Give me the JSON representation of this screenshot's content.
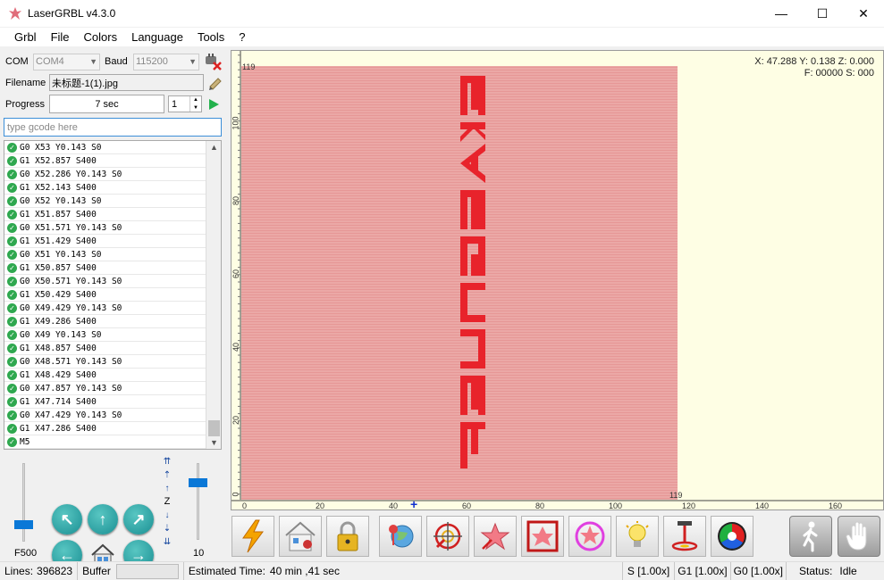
{
  "window": {
    "title": "LaserGRBL v4.3.0",
    "controls": {
      "minimize": "—",
      "maximize": "☐",
      "close": "✕"
    }
  },
  "menu": [
    "Grbl",
    "File",
    "Colors",
    "Language",
    "Tools",
    "?"
  ],
  "connection": {
    "com_label": "COM",
    "com_value": "COM4",
    "baud_label": "Baud",
    "baud_value": "115200"
  },
  "file": {
    "filename_label": "Filename",
    "filename_value": "未标题-1(1).jpg"
  },
  "progress": {
    "label": "Progress",
    "time": "7 sec",
    "passes": "1"
  },
  "gcode_input": {
    "placeholder": "type gcode here"
  },
  "gcode_lines": [
    "G0 X53 Y0.143 S0",
    "G1 X52.857 S400",
    "G0 X52.286 Y0.143 S0",
    "G1 X52.143 S400",
    "G0 X52 Y0.143 S0",
    "G1 X51.857 S400",
    "G0 X51.571 Y0.143 S0",
    "G1 X51.429 S400",
    "G0 X51 Y0.143 S0",
    "G1 X50.857 S400",
    "G0 X50.571 Y0.143 S0",
    "G1 X50.429 S400",
    "G0 X49.429 Y0.143 S0",
    "G1 X49.286 S400",
    "G0 X49 Y0.143 S0",
    "G1 X48.857 S400",
    "G0 X48.571 Y0.143 S0",
    "G1 X48.429 S400",
    "G0 X47.857 Y0.143 S0",
    "G1 X47.714 S400",
    "G0 X47.429 Y0.143 S0",
    "G1 X47.286 S400",
    "M5"
  ],
  "jog": {
    "feed_label": "F500",
    "step_label": "10",
    "z_label": "Z",
    "feed_level": 0.2,
    "step_level": 0.78
  },
  "canvas": {
    "coords_line1": "X: 47.288 Y: 0.138 Z: 0.000",
    "coords_line2": "F: 00000 S: 000",
    "corner_top": "119",
    "corner_right": "119",
    "engraved_text": "FEUNGSAKE",
    "y_ticks": [
      "100",
      "80",
      "60",
      "40",
      "20",
      "0"
    ],
    "x_ticks": [
      "0",
      "20",
      "40",
      "60",
      "80",
      "100",
      "120",
      "140",
      "160"
    ],
    "bg_color": "#fefee4",
    "engrave_color": "#eba8a6",
    "text_color": "#e8232b"
  },
  "toolbar": [
    "flash-icon",
    "home-lock-icon",
    "lock-icon",
    "globe-icon",
    "crosshair-icon",
    "star-icon",
    "frame-icon",
    "ring-icon",
    "bulb-icon",
    "focus-icon",
    "tricolor-icon",
    "walk-icon",
    "hand-icon"
  ],
  "status": {
    "lines_label": "Lines:",
    "lines_value": "396823",
    "buffer_label": "Buffer",
    "estimated_label": "Estimated Time:",
    "estimated_value": "40 min ,41 sec",
    "s_override": "S [1.00x]",
    "g1_override": "G1 [1.00x]",
    "g0_override": "G0 [1.00x]",
    "status_label": "Status:",
    "status_value": "Idle"
  }
}
